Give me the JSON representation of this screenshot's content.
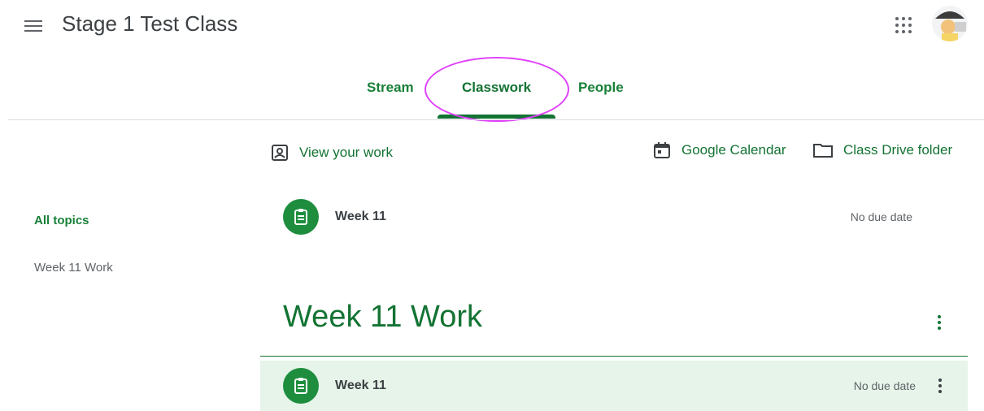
{
  "header": {
    "class_title": "Stage 1 Test Class",
    "menu_icon": "hamburger-menu-icon",
    "apps_icon": "google-apps-grid-icon",
    "avatar_icon": "user-avatar"
  },
  "tabs": [
    {
      "label": "Stream",
      "active": false
    },
    {
      "label": "Classwork",
      "active": true
    },
    {
      "label": "People",
      "active": false
    }
  ],
  "toolbar": {
    "view_work": "View your work",
    "calendar": "Google Calendar",
    "drive_folder": "Class Drive folder"
  },
  "topics": {
    "all_label": "All topics",
    "items": [
      "Week 11 Work"
    ]
  },
  "classwork": {
    "unassigned_items": [
      {
        "title": "Week 11",
        "due": "No due date"
      }
    ],
    "sections": [
      {
        "heading": "Week 11 Work",
        "items": [
          {
            "title": "Week 11",
            "due": "No due date"
          }
        ]
      }
    ]
  },
  "colors": {
    "accent_green": "#137333",
    "icon_green": "#1e8e3e",
    "highlight_row": "#e6f4ea",
    "annotation_magenta": "#e040fb"
  }
}
